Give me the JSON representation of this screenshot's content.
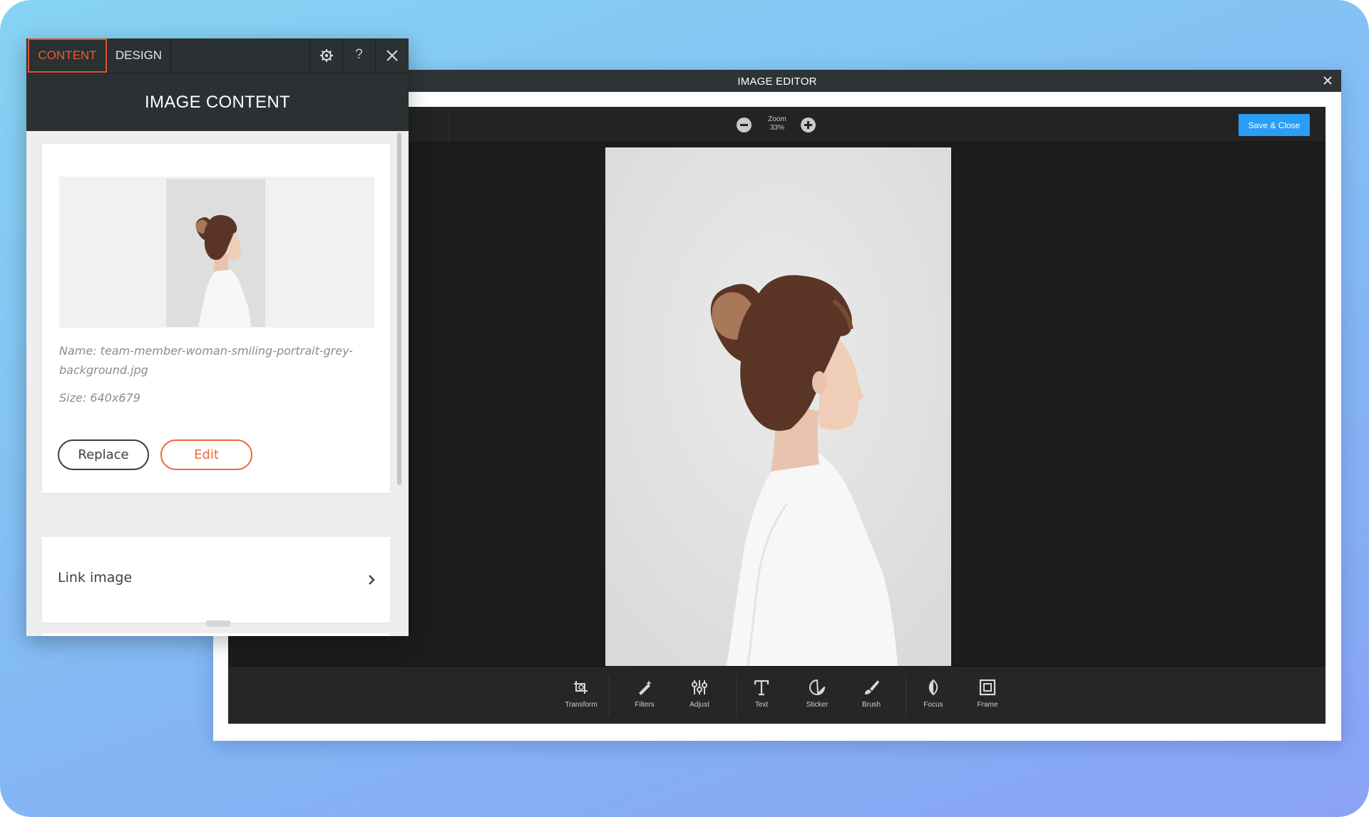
{
  "panel": {
    "tabs": [
      {
        "label": "CONTENT",
        "active": true
      },
      {
        "label": "DESIGN",
        "active": false
      }
    ],
    "controls": {
      "settings_icon": "gear-icon",
      "help_label": "?",
      "close_icon": "close-icon"
    },
    "header_title": "IMAGE CONTENT",
    "image_card": {
      "name_text": "Name: team-member-woman-smiling-portrait-grey-background.jpg",
      "size_text": "Size: 640x679",
      "replace_label": "Replace",
      "edit_label": "Edit"
    },
    "link_card": {
      "label": "Link image",
      "chevron_icon": "chevron-right-icon"
    },
    "accent_color": "#f25a2b"
  },
  "editor": {
    "title": "IMAGE EDITOR",
    "close_icon": "close-icon",
    "zoom": {
      "label": "Zoom",
      "value": "33%"
    },
    "save_label": "Save & Close",
    "save_color": "#2a9df4",
    "tools": [
      {
        "label": "Transform",
        "icon": "transform-icon"
      },
      {
        "label": "Filters",
        "icon": "filters-icon"
      },
      {
        "label": "Adjust",
        "icon": "adjust-icon"
      },
      {
        "label": "Text",
        "icon": "text-icon"
      },
      {
        "label": "Sticker",
        "icon": "sticker-icon"
      },
      {
        "label": "Brush",
        "icon": "brush-icon"
      },
      {
        "label": "Focus",
        "icon": "focus-icon"
      },
      {
        "label": "Frame",
        "icon": "frame-icon"
      }
    ]
  }
}
